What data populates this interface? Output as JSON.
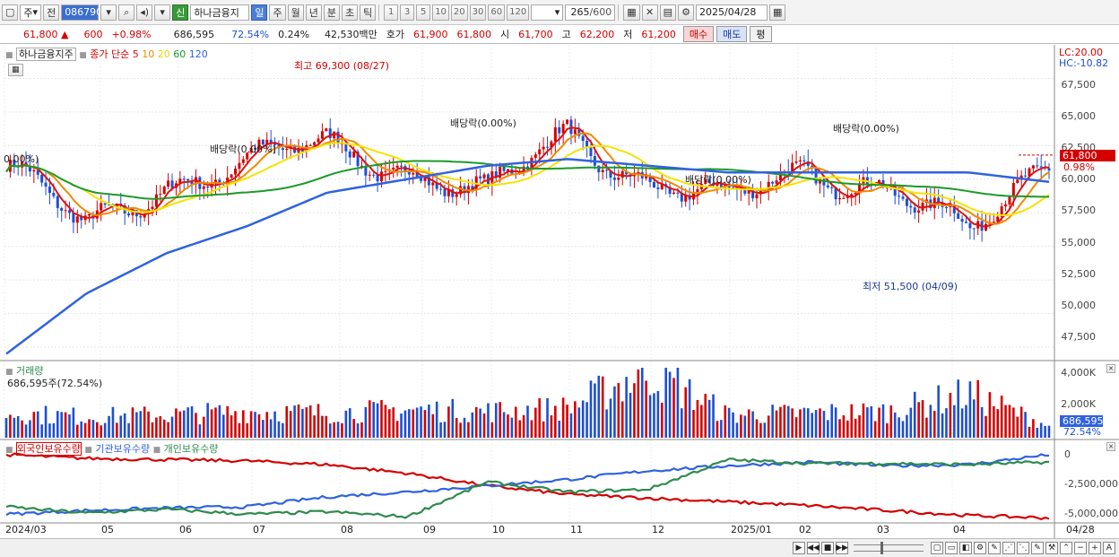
{
  "toolbar": {
    "period_unit": "주",
    "prev_label": "전",
    "stock_code": "086790",
    "credit_label": "신",
    "stock_name": "하나금융지",
    "periods": [
      "일",
      "주",
      "월",
      "년",
      "분",
      "초",
      "틱"
    ],
    "active_period": "일",
    "intervals": [
      "1",
      "3",
      "5",
      "10",
      "20",
      "30",
      "60",
      "120"
    ],
    "count": "265",
    "count_total": "/600",
    "date": "2025/04/28"
  },
  "quote": {
    "price": "61,800",
    "arrow": "▲",
    "change": "600",
    "change_pct": "+0.98%",
    "volume": "686,595",
    "volume_ratio": "72.54%",
    "turnover_pct": "0.24%",
    "amount": "42,530백만",
    "ask_label": "호가",
    "ask1": "61,900",
    "ask2": "61,800",
    "open_label": "시",
    "open": "61,700",
    "high_label": "고",
    "high": "62,200",
    "low_label": "저",
    "low": "61,200",
    "buy_label": "매수",
    "sell_label": "매도",
    "avg_label": "평"
  },
  "price_panel": {
    "stock_label": "하나금융지주",
    "ma_label": "종가 단순",
    "ma_periods": [
      "5",
      "10",
      "20",
      "60",
      "120"
    ],
    "lc": "LC:20.00",
    "hc": "HC:-10.82",
    "y_ticks": [
      "67,500",
      "65,000",
      "62,500",
      "60,000",
      "57,500",
      "55,000",
      "52,500",
      "50,000",
      "47,500"
    ],
    "current_price": "61,800",
    "current_pct": "0.98%",
    "high_note": "최고 69,300 (08/27)",
    "low_note": "최저 51,500 (04/09)",
    "ex_div": [
      "0.00%)",
      "배당락(0.00%)",
      "배당락(0.00%)",
      "배당락(0.00%)",
      "배당락(0.00%)"
    ]
  },
  "volume_panel": {
    "title": "거래량",
    "value": "686,595주(72.54%)",
    "y_ticks": [
      "4,000K",
      "2,000K"
    ],
    "current": "686,595",
    "current_pct": "72.54%"
  },
  "holder_panel": {
    "series_labels": [
      "외국인보유수량",
      "기관보유수량",
      "개인보유수량"
    ],
    "y_ticks": [
      "0",
      "-2,500,000",
      "-5,000,000"
    ]
  },
  "x_axis": {
    "labels": [
      "2024/03",
      "05",
      "06",
      "07",
      "08",
      "09",
      "10",
      "11",
      "12",
      "2025/01",
      "02",
      "03",
      "04"
    ],
    "right_label": "04/28"
  },
  "colors": {
    "up": "#d40000",
    "down": "#1d4fd3",
    "ma5": "#dd1111",
    "ma10": "#f08a00",
    "ma20": "#f2e400",
    "ma60": "#1b9a2a",
    "ma120": "#2f62e0",
    "foreign": "#d40000",
    "institution": "#2f62e0",
    "individual": "#2e8a4e"
  },
  "chart_data": [
    {
      "type": "line",
      "title": "하나금융지주",
      "ylim": [
        46500,
        70000
      ],
      "x": [
        "2024/03",
        "05",
        "06",
        "07",
        "08",
        "09",
        "10",
        "11",
        "12",
        "2025/01",
        "02",
        "03",
        "04",
        "04/28"
      ],
      "series": [
        {
          "name": "종가",
          "values": [
            61000,
            56000,
            60000,
            61000,
            62500,
            61000,
            58500,
            63500,
            60000,
            58000,
            61000,
            59500,
            55500,
            61800
          ]
        },
        {
          "name": "120",
          "values": [
            47000,
            51500,
            54500,
            56500,
            59000,
            60000,
            61000,
            61500,
            61000,
            60500,
            60500,
            60500,
            60500,
            59800
          ]
        }
      ]
    },
    {
      "type": "bar",
      "title": "거래량",
      "ylim": [
        0,
        4000000
      ],
      "x": [
        "2024/03",
        "05",
        "06",
        "07",
        "08",
        "09",
        "10",
        "11",
        "12",
        "2025/01",
        "02",
        "03",
        "04",
        "04/28"
      ],
      "values": [
        1400000,
        1200000,
        1300000,
        1500000,
        1400000,
        1600000,
        1500000,
        1700000,
        3800000,
        1300000,
        1400000,
        1500000,
        2500000,
        686595
      ]
    },
    {
      "type": "line",
      "title": "",
      "ylim": [
        -5500000,
        500000
      ],
      "x": [
        "2024/03",
        "05",
        "06",
        "07",
        "08",
        "09",
        "10",
        "11",
        "12",
        "2025/01",
        "02",
        "03",
        "04",
        "04/28"
      ],
      "series": [
        {
          "name": "외국인보유수량",
          "values": [
            0,
            -300000,
            -400000,
            -500000,
            -800000,
            -1500000,
            -2500000,
            -3200000,
            -3500000,
            -3800000,
            -4100000,
            -4500000,
            -4900000,
            -5100000
          ]
        },
        {
          "name": "기관보유수량",
          "values": [
            -4800000,
            -4500000,
            -4300000,
            -4200000,
            -3400000,
            -3000000,
            -2500000,
            -2000000,
            -1300000,
            -900000,
            -600000,
            -900000,
            -800000,
            0
          ]
        },
        {
          "name": "개인보유수량",
          "values": [
            -4200000,
            -4700000,
            -4400000,
            -4800000,
            -4600000,
            -5000000,
            -2200000,
            -3000000,
            -2800000,
            -400000,
            -700000,
            -700000,
            -800000,
            -600000
          ]
        }
      ]
    }
  ]
}
